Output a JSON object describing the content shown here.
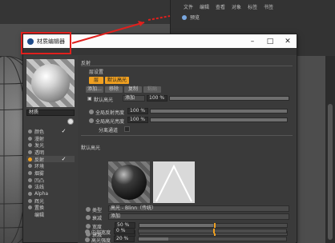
{
  "outliner": {
    "menu": [
      "文件",
      "编辑",
      "查看",
      "对象",
      "标签",
      "书签"
    ],
    "object_name": "预览"
  },
  "window": {
    "title": "材质编辑器",
    "controls": {
      "minimize": "–",
      "maximize": "□",
      "close": "✕"
    }
  },
  "material": {
    "name": "材质",
    "channels": [
      {
        "label": "颜色",
        "checked": true
      },
      {
        "label": "漫射",
        "checked": false
      },
      {
        "label": "发光",
        "checked": false
      },
      {
        "label": "透明",
        "checked": false
      },
      {
        "label": "反射",
        "checked": true
      },
      {
        "label": "环境",
        "checked": false
      },
      {
        "label": "烟雾",
        "checked": false
      },
      {
        "label": "凹凸",
        "checked": false
      },
      {
        "label": "法线",
        "checked": false
      },
      {
        "label": "Alpha",
        "checked": false
      },
      {
        "label": "辉光",
        "checked": false
      },
      {
        "label": "置换",
        "checked": false
      }
    ],
    "footer": "编辑"
  },
  "reflectance": {
    "section_label": "反射",
    "subsection_label": "层设置",
    "tabs": [
      "层",
      "默认高光"
    ],
    "buttons": [
      "添加...",
      "移除",
      "复制",
      "粘贴"
    ],
    "layer_row": {
      "label": "默认高光",
      "mode": "添加",
      "percent": "100 %",
      "percent_value": 100
    },
    "global_reflection_label": "全局反射亮度",
    "global_reflection_value": "100 %",
    "global_reflection_fill": 100,
    "global_specular_label": "全局高光亮度",
    "global_specular_value": "100 %",
    "global_specular_fill": 100,
    "separate_pass_label": "分离通道",
    "default_spec_section": "默认高光",
    "type_label": "类型",
    "type_value": "高光 - Blinn（传统）",
    "attenuation_label": "衰减",
    "attenuation_value": "添加",
    "width_label": "宽度",
    "width_value": "50 %",
    "width_fill": 50,
    "falloff_label": "衰减",
    "falloff_value": "0 %",
    "falloff_fill": 0,
    "inner_width_label": "内部宽度",
    "inner_width_value": "0 %",
    "inner_width_fill": 0,
    "spec_strength_label": "高光强度",
    "spec_strength_value": "20 %",
    "spec_strength_fill": 20
  }
}
